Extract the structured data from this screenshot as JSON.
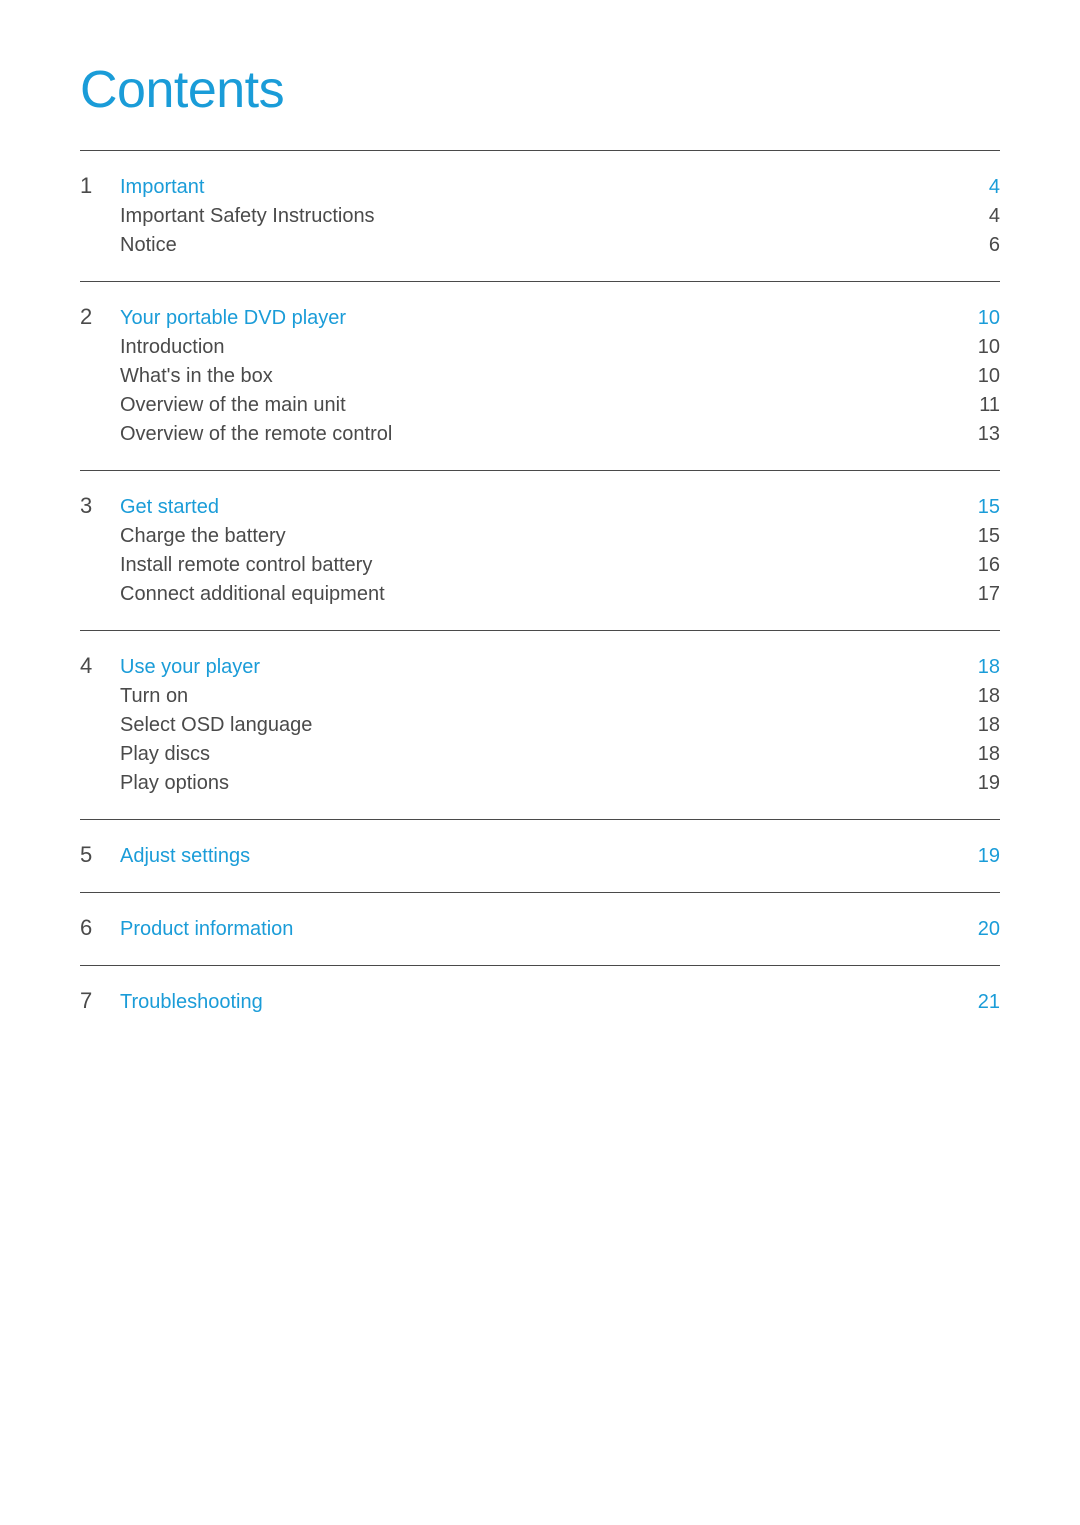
{
  "title": "Contents",
  "sections": [
    {
      "number": "1",
      "title": "Important",
      "page": "4",
      "subsections": [
        {
          "label": "Important Safety Instructions",
          "page": "4"
        },
        {
          "label": "Notice",
          "page": "6"
        }
      ]
    },
    {
      "number": "2",
      "title": "Your portable DVD player",
      "page": "10",
      "subsections": [
        {
          "label": "Introduction",
          "page": "10"
        },
        {
          "label": "What's in the box",
          "page": "10"
        },
        {
          "label": "Overview of the main unit",
          "page": "11"
        },
        {
          "label": "Overview of the remote control",
          "page": "13"
        }
      ]
    },
    {
      "number": "3",
      "title": "Get started",
      "page": "15",
      "subsections": [
        {
          "label": "Charge the battery",
          "page": "15"
        },
        {
          "label": "Install remote control battery",
          "page": "16"
        },
        {
          "label": "Connect additional equipment",
          "page": "17"
        }
      ]
    },
    {
      "number": "4",
      "title": "Use your player",
      "page": "18",
      "subsections": [
        {
          "label": "Turn on",
          "page": "18"
        },
        {
          "label": "Select OSD language",
          "page": "18"
        },
        {
          "label": "Play discs",
          "page": "18"
        },
        {
          "label": "Play options",
          "page": "19"
        }
      ]
    },
    {
      "number": "5",
      "title": "Adjust settings",
      "page": "19",
      "subsections": []
    },
    {
      "number": "6",
      "title": "Product information",
      "page": "20",
      "subsections": []
    },
    {
      "number": "7",
      "title": "Troubleshooting",
      "page": "21",
      "subsections": []
    }
  ]
}
